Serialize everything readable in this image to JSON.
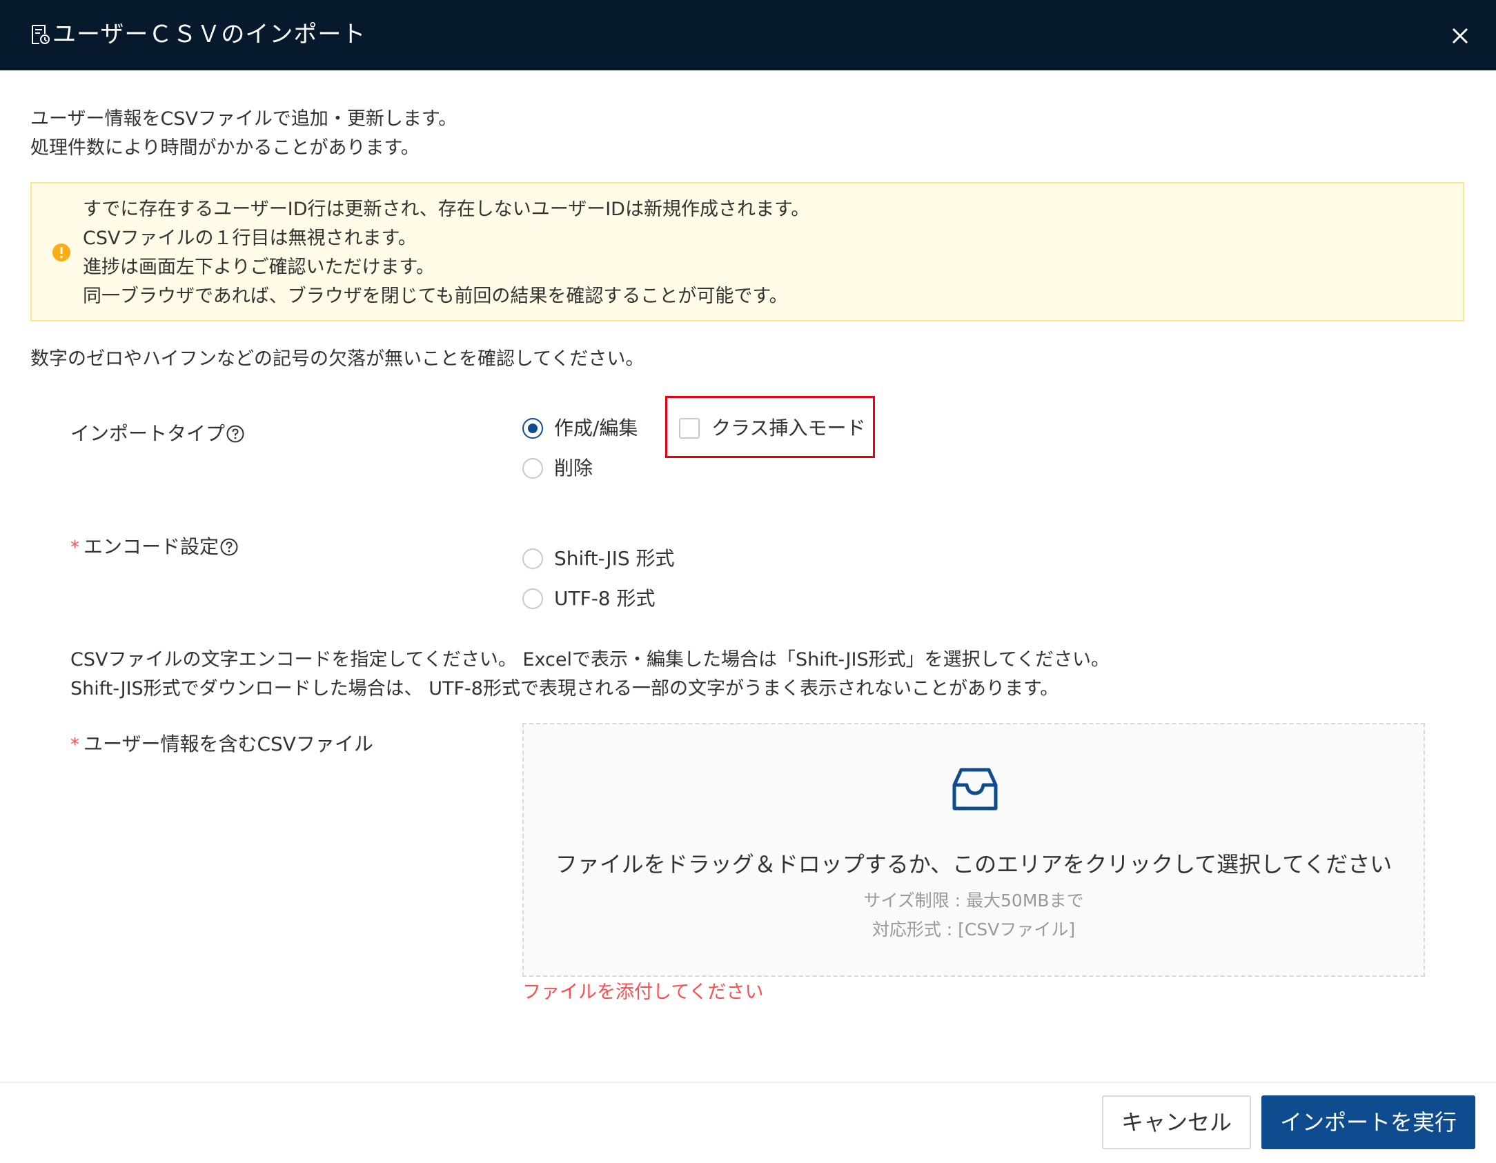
{
  "header": {
    "title": "ユーザーＣＳＶのインポート",
    "icon": "document-icon",
    "close_label": "X"
  },
  "intro": {
    "line1": "ユーザー情報をCSVファイルで追加・更新します。",
    "line2": "処理件数により時間がかかることがあります。"
  },
  "notice": {
    "icon": "exclamation-circle-icon",
    "lines": [
      "すでに存在するユーザーID行は更新され、存在しないユーザーIDは新規作成されます。",
      "CSVファイルの１行目は無視されます。",
      "進捗は画面左下よりご確認いただけます。",
      "同一ブラウザであれば、ブラウザを閉じても前回の結果を確認することが可能です。"
    ]
  },
  "check_note": "数字のゼロやハイフンなどの記号の欠落が無いことを確認してください。",
  "import_type": {
    "label": "インポートタイプ",
    "options": [
      "作成/編集",
      "削除"
    ],
    "selected": "作成/編集",
    "class_insert_mode_label": "クラス挿入モード",
    "class_insert_mode_checked": false
  },
  "encoding": {
    "required_mark": "*",
    "label": "エンコード設定",
    "options": [
      "Shift-JIS 形式",
      "UTF-8 形式"
    ],
    "selected": null,
    "help_line1": "CSVファイルの文字エンコードを指定してください。 Excelで表示・編集した場合は「Shift-JIS形式」を選択してください。",
    "help_line2": "Shift-JIS形式でダウンロードした場合は、 UTF-8形式で表現される一部の文字がうまく表示されないことがあります。"
  },
  "file_upload": {
    "required_mark": "*",
    "label": "ユーザー情報を含むCSVファイル",
    "icon": "inbox-icon",
    "main_text": "ファイルをドラッグ＆ドロップするか、このエリアをクリックして選択してください",
    "size_limit": "サイズ制限 : 最大50MBまで",
    "formats": "対応形式 : [CSVファイル]",
    "error": "ファイルを添付してください"
  },
  "footer": {
    "cancel_label": "キャンセル",
    "submit_label": "インポートを実行"
  },
  "colors": {
    "header_bg": "#06192d",
    "primary": "#0f4c8f",
    "error": "#ff4d4f",
    "notice_bg": "#fffbe6",
    "notice_border": "#ffe58f",
    "warn_icon": "#faad14",
    "highlight": "#e60012"
  }
}
